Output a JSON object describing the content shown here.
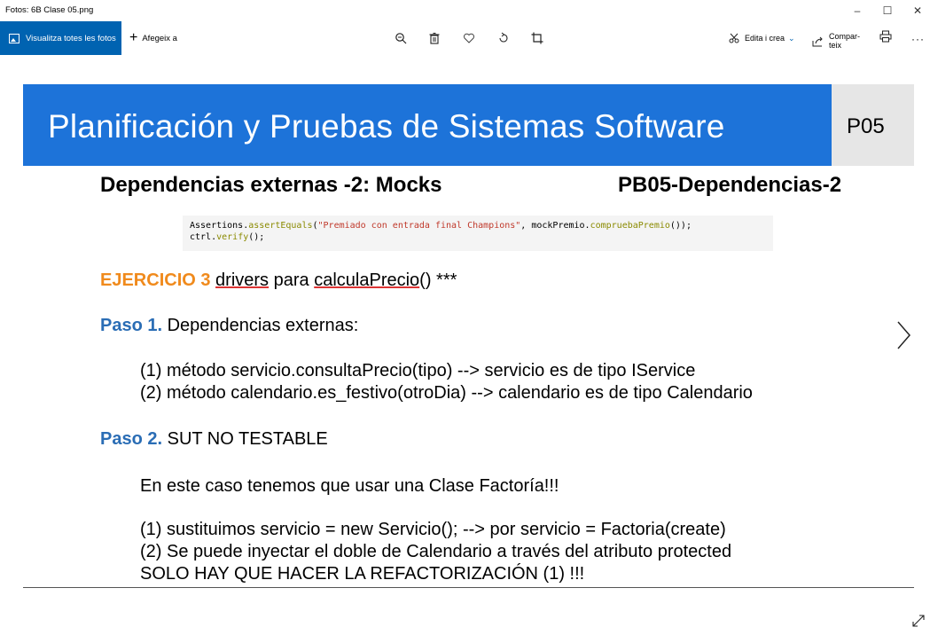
{
  "window": {
    "title": "Fotos: 6B Clase 05.png",
    "minimize": "–",
    "maximize": "☐",
    "close": "✕"
  },
  "toolbar": {
    "view_all_label": "Visualitza totes les fotos",
    "add_to_label": "Afegeix a",
    "edit_create_label": "Edita i crea",
    "share_label_1": "Compar-",
    "share_label_2": "teix",
    "more_label": "···",
    "icons": [
      "zoom-icon",
      "delete-icon",
      "favorite-icon",
      "rotate-icon",
      "crop-icon",
      "print-icon"
    ]
  },
  "slide": {
    "header_title": "Planificación y Pruebas de Sistemas Software",
    "header_code": "P05",
    "subtitle_left": "Dependencias externas -2: Mocks",
    "subtitle_right": "PB05-Dependencias-2",
    "code_line1_prefix": "Assertions.",
    "code_line1_fn": "assertEquals",
    "code_line1_open": "(",
    "code_line1_str": "\"Premiado con entrada final Champions\"",
    "code_line1_mid": ", mockPremio.",
    "code_line1_fn2": "compruebaPremio",
    "code_line1_end": "());",
    "code_line2_prefix": "ctrl.",
    "code_line2_fn": "verify",
    "code_line2_end": "();",
    "ejercicio_label": "EJERCICIO 3",
    "ejercicio_text_1": "drivers",
    "ejercicio_text_2": " para ",
    "ejercicio_text_3": "calculaPrecio",
    "ejercicio_text_4": "() ***",
    "paso1_label": "Paso 1.",
    "paso1_text": " Dependencias externas:",
    "paso1_item1": "(1) método servicio.consultaPrecio(tipo) --> servicio es de tipo IService",
    "paso1_item2": "(2) método calendario.es_festivo(otroDia) --> calendario es de tipo Calendario",
    "paso2_label": "Paso 2.",
    "paso2_text": " SUT NO TESTABLE",
    "paso2_line1": "En este caso tenemos que usar una Clase Factoría!!!",
    "paso2_item1": "(1) sustituimos servicio = new Servicio(); --> por servicio = Factoria(create)",
    "paso2_item2": "(2) Se puede inyectar el doble de Calendario a través del atributo protected",
    "paso2_line3": "SOLO HAY QUE HACER LA REFACTORIZACIÓN (1) !!!"
  }
}
